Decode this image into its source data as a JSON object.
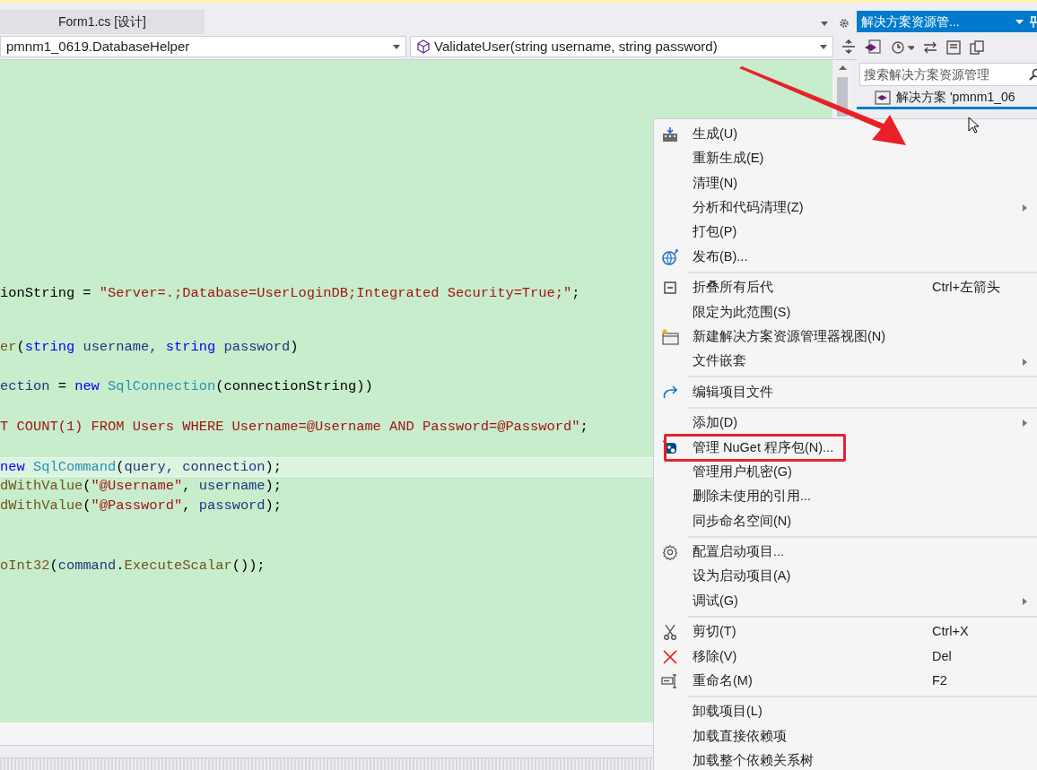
{
  "document_tabs": [
    {
      "label": "Form1.cs [设计]",
      "selected": false
    }
  ],
  "navigation_bar": {
    "type_dropdown": "pmnm1_0619.DatabaseHelper",
    "member_dropdown": "ValidateUser(string username, string password)"
  },
  "code_lines": [
    {
      "current": false,
      "tokens": [
        {
          "text": "ionString = ",
          "kind": "plain"
        },
        {
          "text": "\"Server=.;Database=UserLoginDB;Integrated Security=True;\"",
          "kind": "string"
        },
        {
          "text": ";",
          "kind": "plain"
        }
      ]
    },
    {
      "current": false,
      "tokens": [
        {
          "text": "er",
          "kind": "method"
        },
        {
          "text": "(",
          "kind": "plain"
        },
        {
          "text": "string",
          "kind": "keyword"
        },
        {
          "text": " username, ",
          "kind": "variable"
        },
        {
          "text": "string",
          "kind": "keyword"
        },
        {
          "text": " password",
          "kind": "variable"
        },
        {
          "text": ")",
          "kind": "plain"
        }
      ]
    },
    {
      "current": false,
      "tokens": [
        {
          "text": "ection",
          "kind": "variable"
        },
        {
          "text": " = ",
          "kind": "plain"
        },
        {
          "text": "new ",
          "kind": "keyword"
        },
        {
          "text": "SqlConnection",
          "kind": "type"
        },
        {
          "text": "(connectionString))",
          "kind": "plain"
        }
      ]
    },
    {
      "current": false,
      "tokens": [
        {
          "text": "T COUNT(1) FROM Users WHERE Username=@Username AND Password=@Password\"",
          "kind": "string"
        },
        {
          "text": ";",
          "kind": "plain"
        }
      ]
    },
    {
      "current": true,
      "tokens": [
        {
          "text": "new ",
          "kind": "keyword"
        },
        {
          "text": "SqlCommand",
          "kind": "type"
        },
        {
          "text": "(",
          "kind": "plain"
        },
        {
          "text": "query, connection",
          "kind": "variable"
        },
        {
          "text": ");",
          "kind": "plain"
        }
      ]
    },
    {
      "current": false,
      "tokens": [
        {
          "text": "dWithValue",
          "kind": "method"
        },
        {
          "text": "(",
          "kind": "plain"
        },
        {
          "text": "\"@Username\"",
          "kind": "string"
        },
        {
          "text": ", ",
          "kind": "plain"
        },
        {
          "text": "username",
          "kind": "variable"
        },
        {
          "text": ");",
          "kind": "plain"
        }
      ]
    },
    {
      "current": false,
      "tokens": [
        {
          "text": "dWithValue",
          "kind": "method"
        },
        {
          "text": "(",
          "kind": "plain"
        },
        {
          "text": "\"@Password\"",
          "kind": "string"
        },
        {
          "text": ", ",
          "kind": "plain"
        },
        {
          "text": "password",
          "kind": "variable"
        },
        {
          "text": ");",
          "kind": "plain"
        }
      ]
    },
    {
      "current": false,
      "tokens": [
        {
          "text": "oInt32",
          "kind": "method"
        },
        {
          "text": "(",
          "kind": "plain"
        },
        {
          "text": "command",
          "kind": "variable"
        },
        {
          "text": ".",
          "kind": "plain"
        },
        {
          "text": "ExecuteScalar",
          "kind": "method"
        },
        {
          "text": "());",
          "kind": "plain"
        }
      ]
    }
  ],
  "solution_explorer": {
    "title": "解决方案资源管...",
    "search": {
      "placeholder": "搜索解决方案资源管理"
    },
    "items": [
      {
        "label": "解决方案 'pmnm1_06",
        "selected": true
      }
    ]
  },
  "context_menu": [
    {
      "kind": "item",
      "label": "生成(U)",
      "submenu": false,
      "annotated": false
    },
    {
      "kind": "item",
      "label": "重新生成(E)",
      "submenu": false,
      "annotated": false
    },
    {
      "kind": "item",
      "label": "清理(N)",
      "submenu": false,
      "annotated": false
    },
    {
      "kind": "item",
      "label": "分析和代码清理(Z)",
      "submenu": true,
      "annotated": false
    },
    {
      "kind": "item",
      "label": "打包(P)",
      "submenu": false,
      "annotated": false
    },
    {
      "kind": "item",
      "label": "发布(B)...",
      "submenu": false,
      "annotated": false
    },
    {
      "kind": "separator"
    },
    {
      "kind": "item",
      "label": "折叠所有后代",
      "shortcut": "Ctrl+左箭头",
      "submenu": false,
      "annotated": false
    },
    {
      "kind": "item",
      "label": "限定为此范围(S)",
      "submenu": false,
      "annotated": false
    },
    {
      "kind": "item",
      "label": "新建解决方案资源管理器视图(N)",
      "submenu": false,
      "annotated": false
    },
    {
      "kind": "item",
      "label": "文件嵌套",
      "submenu": true,
      "annotated": false
    },
    {
      "kind": "separator"
    },
    {
      "kind": "item",
      "label": "编辑项目文件",
      "submenu": false,
      "annotated": false
    },
    {
      "kind": "separator"
    },
    {
      "kind": "item",
      "label": "添加(D)",
      "submenu": true,
      "annotated": false
    },
    {
      "kind": "item",
      "label": "管理 NuGet 程序包(N)...",
      "submenu": false,
      "annotated": true
    },
    {
      "kind": "item",
      "label": "管理用户机密(G)",
      "submenu": false,
      "annotated": false
    },
    {
      "kind": "item",
      "label": "删除未使用的引用...",
      "submenu": false,
      "annotated": false
    },
    {
      "kind": "item",
      "label": "同步命名空间(N)",
      "submenu": false,
      "annotated": false
    },
    {
      "kind": "separator"
    },
    {
      "kind": "item",
      "label": "配置启动项目...",
      "submenu": false,
      "annotated": false
    },
    {
      "kind": "item",
      "label": "设为启动项目(A)",
      "submenu": false,
      "annotated": false
    },
    {
      "kind": "item",
      "label": "调试(G)",
      "submenu": true,
      "annotated": false
    },
    {
      "kind": "separator"
    },
    {
      "kind": "item",
      "label": "剪切(T)",
      "shortcut": "Ctrl+X",
      "submenu": false,
      "annotated": false
    },
    {
      "kind": "item",
      "label": "移除(V)",
      "shortcut": "Del",
      "submenu": false,
      "annotated": false
    },
    {
      "kind": "item",
      "label": "重命名(M)",
      "shortcut": "F2",
      "submenu": false,
      "annotated": false
    },
    {
      "kind": "separator"
    },
    {
      "kind": "item",
      "label": "卸载项目(L)",
      "submenu": false,
      "annotated": false
    },
    {
      "kind": "item",
      "label": "加载直接依赖项",
      "submenu": false,
      "annotated": false
    },
    {
      "kind": "item",
      "label": "加载整个依赖关系树",
      "submenu": false,
      "annotated": false
    }
  ]
}
